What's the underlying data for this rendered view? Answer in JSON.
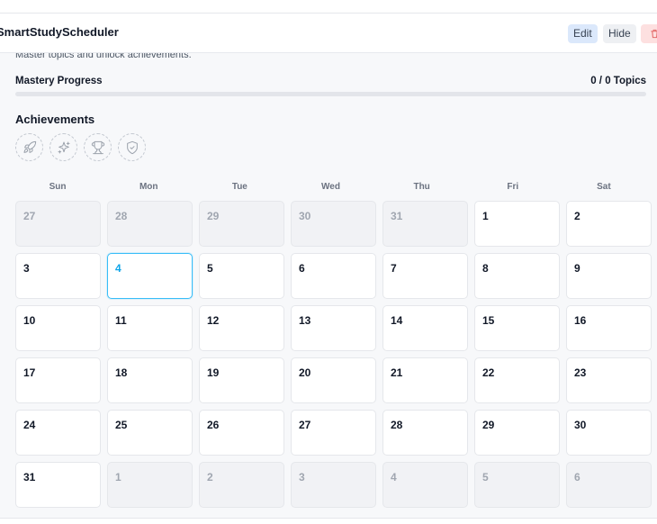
{
  "app": {
    "title": "SmartStudyScheduler"
  },
  "header": {
    "edit_label": "Edit",
    "hide_label": "Hide",
    "delete_icon": "trash-icon"
  },
  "intro": {
    "subtitle": "Master topics and unlock achievements."
  },
  "progress": {
    "label": "Mastery Progress",
    "count_text": "0 / 0 Topics",
    "percent": 0
  },
  "achievements": {
    "title": "Achievements",
    "badges": [
      "rocket-icon",
      "sparkles-icon",
      "trophy-icon",
      "shield-check-icon"
    ]
  },
  "calendar": {
    "weekdays": [
      "Sun",
      "Mon",
      "Tue",
      "Wed",
      "Thu",
      "Fri",
      "Sat"
    ],
    "days": [
      {
        "n": "27",
        "other": true
      },
      {
        "n": "28",
        "other": true
      },
      {
        "n": "29",
        "other": true
      },
      {
        "n": "30",
        "other": true
      },
      {
        "n": "31",
        "other": true
      },
      {
        "n": "1"
      },
      {
        "n": "2"
      },
      {
        "n": "3"
      },
      {
        "n": "4",
        "today": true
      },
      {
        "n": "5"
      },
      {
        "n": "6"
      },
      {
        "n": "7"
      },
      {
        "n": "8"
      },
      {
        "n": "9"
      },
      {
        "n": "10"
      },
      {
        "n": "11"
      },
      {
        "n": "12"
      },
      {
        "n": "13"
      },
      {
        "n": "14"
      },
      {
        "n": "15"
      },
      {
        "n": "16"
      },
      {
        "n": "17"
      },
      {
        "n": "18"
      },
      {
        "n": "19"
      },
      {
        "n": "20"
      },
      {
        "n": "21"
      },
      {
        "n": "22"
      },
      {
        "n": "23"
      },
      {
        "n": "24"
      },
      {
        "n": "25"
      },
      {
        "n": "26"
      },
      {
        "n": "27"
      },
      {
        "n": "28"
      },
      {
        "n": "29"
      },
      {
        "n": "30"
      },
      {
        "n": "31"
      },
      {
        "n": "1",
        "other": true
      },
      {
        "n": "2",
        "other": true
      },
      {
        "n": "3",
        "other": true
      },
      {
        "n": "4",
        "other": true
      },
      {
        "n": "5",
        "other": true
      },
      {
        "n": "6",
        "other": true
      }
    ]
  },
  "colors": {
    "accent": "#0ea5e9",
    "edit_bg": "#dbe8fb",
    "delete_bg": "#fde0e0"
  }
}
